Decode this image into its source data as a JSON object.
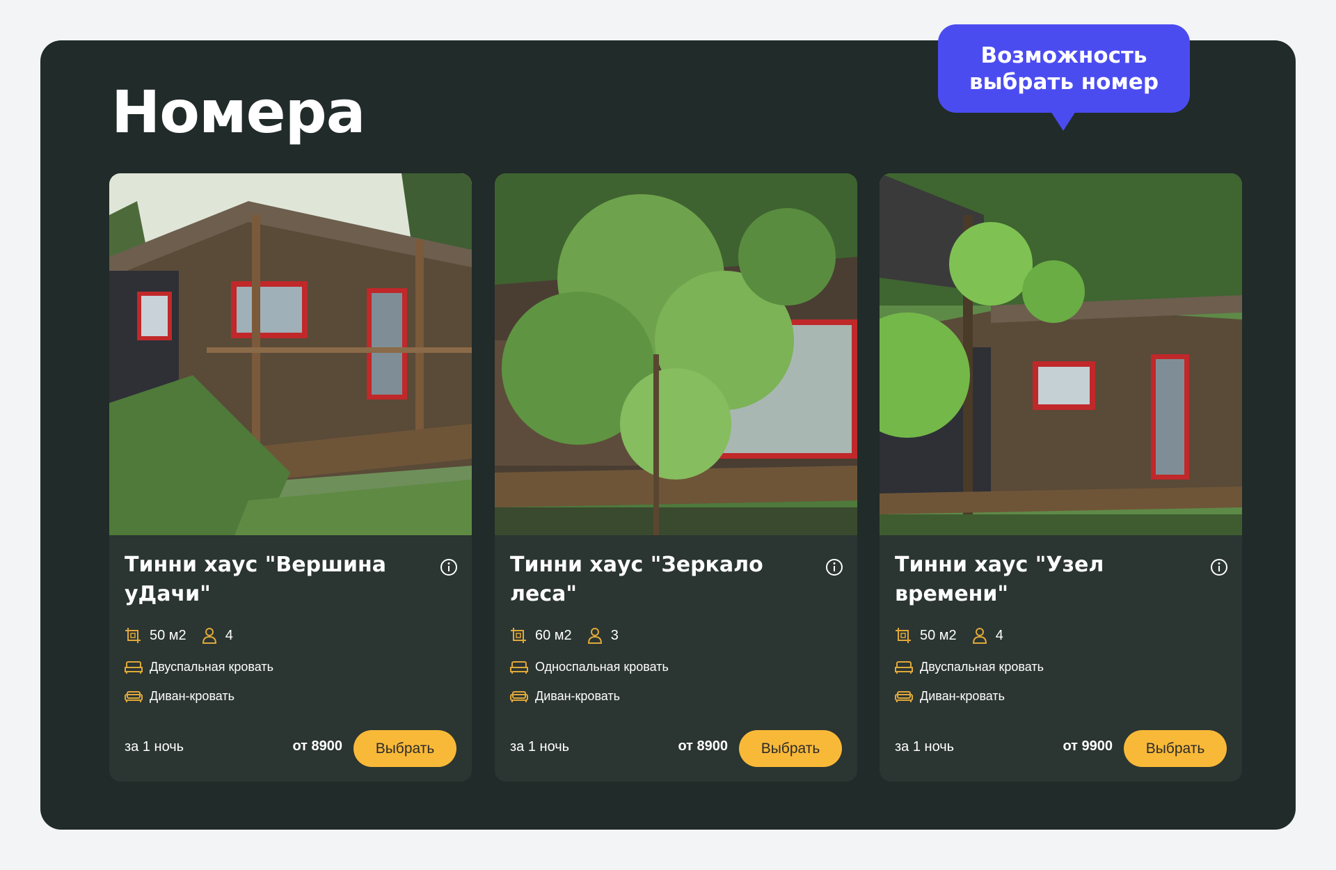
{
  "section": {
    "title": "Номера"
  },
  "callout": {
    "line1": "Возможность",
    "line2": "выбрать номер"
  },
  "colors": {
    "panel": "#212b29",
    "card": "#2b3532",
    "accent": "#f9b938",
    "callout": "#4b4cf0",
    "icon": "#e0a93a"
  },
  "cards": [
    {
      "title": "Тинни хаус \"Вершина уДачи\"",
      "area": "50 м2",
      "guests": "4",
      "bed1": "Двуспальная кровать",
      "bed2": "Диван-кровать",
      "per_night": "за 1 ночь",
      "price": "от 8900",
      "button": "Выбрать",
      "photo_alt": "tiny-house-photo"
    },
    {
      "title": "Тинни хаус \"Зеркало леса\"",
      "area": "60 м2",
      "guests": "3",
      "bed1": "Односпальная кровать",
      "bed2": "Диван-кровать",
      "per_night": "за 1 ночь",
      "price": "от 8900",
      "button": "Выбрать",
      "photo_alt": "tiny-house-photo"
    },
    {
      "title": "Тинни хаус \"Узел времени\"",
      "area": "50 м2",
      "guests": "4",
      "bed1": "Двуспальная кровать",
      "bed2": "Диван-кровать",
      "per_night": "за 1 ночь",
      "price": "от 9900",
      "button": "Выбрать",
      "photo_alt": "tiny-house-photo"
    }
  ]
}
